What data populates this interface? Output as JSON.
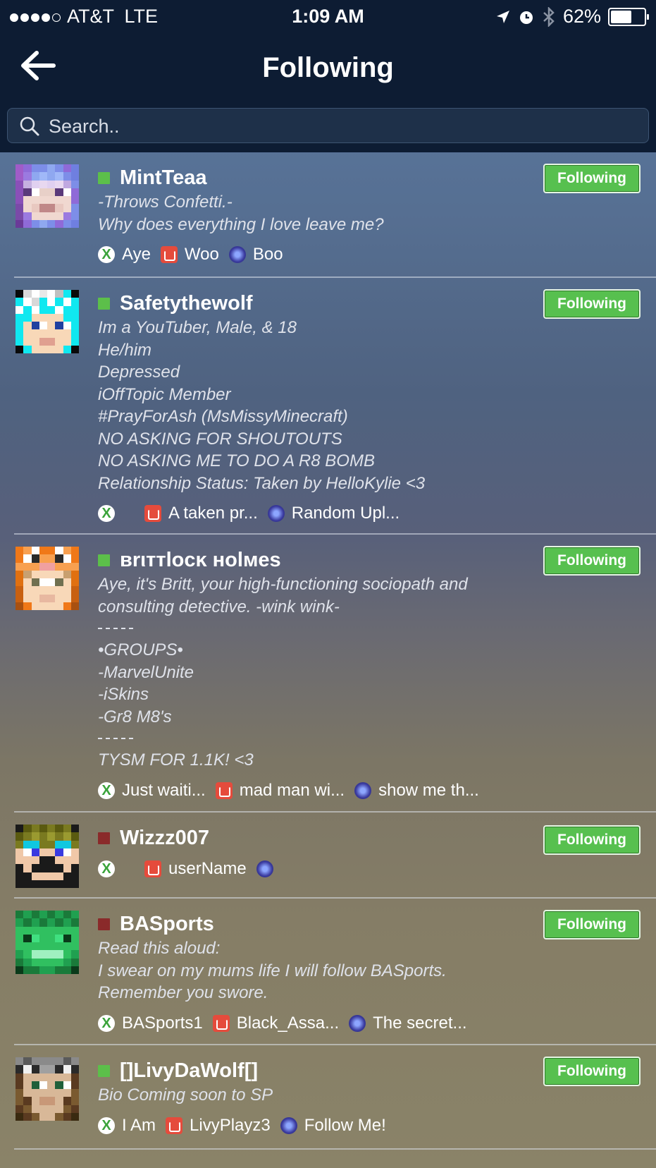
{
  "status_bar": {
    "carrier": "AT&T",
    "network": "LTE",
    "time": "1:09 AM",
    "battery": "62%",
    "battery_level": 0.62
  },
  "header": {
    "title": "Following",
    "back_icon": "back-arrow-icon"
  },
  "search": {
    "placeholder": "Search.."
  },
  "colors": {
    "header_bg": "#0d1c33",
    "online": "#5cbf4a",
    "offline": "#8a2a2a",
    "follow_button": "#57c04f"
  },
  "users": [
    {
      "name": "MintTeaa",
      "online": true,
      "bio": "-Throws Confetti.-\nWhy does everything I love leave me?",
      "links": {
        "xbox": "Aye",
        "mixer": "Woo",
        "star": "Boo"
      },
      "button": "Following"
    },
    {
      "name": "Safetythewolf",
      "online": true,
      "bio": "Im a YouTuber, Male, & 18\nHe/him\nDepressed\niOffTopic Member\n#PrayForAsh (MsMissyMinecraft)\nNO ASKING FOR SHOUTOUTS\nNO ASKING ME TO DO A R8 BOMB\nRelationship Status: Taken by HelloKylie <3",
      "links": {
        "xbox": "",
        "mixer": "A taken pr...",
        "star": "Random Upl..."
      },
      "button": "Following"
    },
    {
      "name": "вrιттlocĸ нolмeѕ",
      "online": true,
      "bio_top": "Aye, it's Britt, your high-functioning sociopath and\nconsulting detective. -wink wink-",
      "bio_mid": "•GROUPS•\n-MarvelUnite\n-iSkins\n-Gr8 M8's",
      "bio_bottom": "TYSM FOR 1.1K! <3",
      "links": {
        "xbox": "Just waiti...",
        "mixer": "mad man wi...",
        "star": "show me th..."
      },
      "button": "Following"
    },
    {
      "name": "Wizzz007",
      "online": false,
      "bio": "",
      "links": {
        "xbox": "",
        "mixer": "userName",
        "star": ""
      },
      "button": "Following"
    },
    {
      "name": "BASports",
      "online": false,
      "bio": "Read this aloud:\nI swear on my mums life I will follow BASports.\nRemember you swore.",
      "links": {
        "xbox": "BASports1",
        "mixer": "Black_Assa...",
        "star": "The secret..."
      },
      "button": "Following"
    },
    {
      "name": "[]LivyDaWolf[]",
      "online": true,
      "bio": "Bio Coming soon to SP",
      "links": {
        "xbox": "I Am",
        "mixer": "LivyPlayz3",
        "star": "Follow Me!"
      },
      "button": "Following"
    }
  ]
}
